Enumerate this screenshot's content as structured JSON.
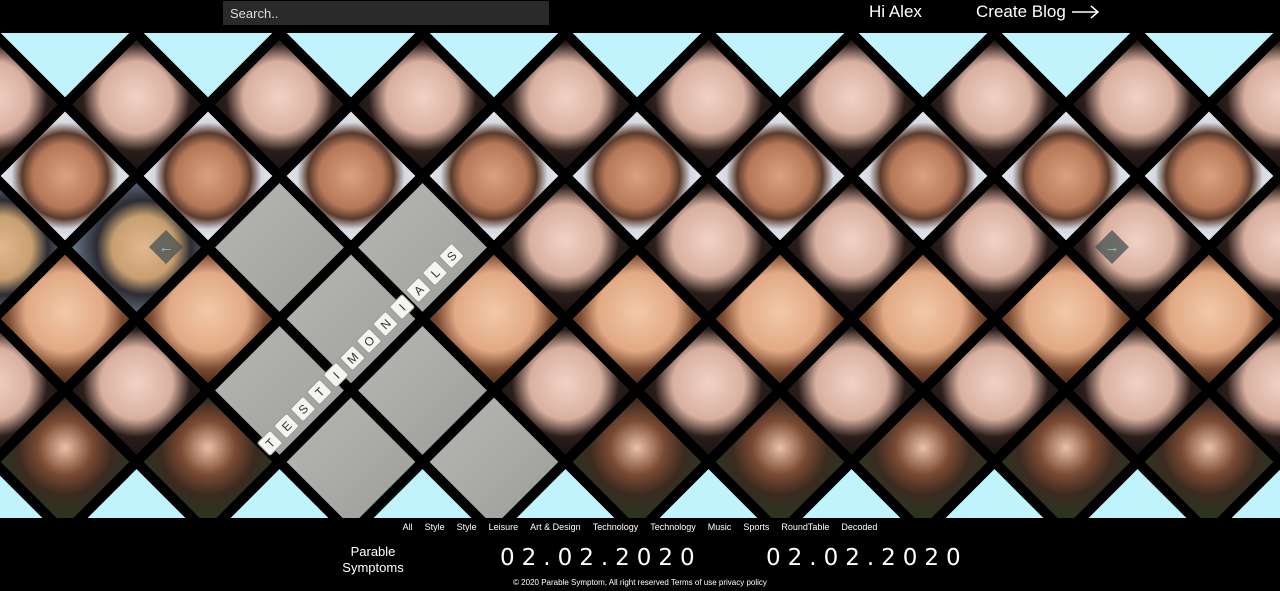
{
  "header": {
    "search_placeholder": "Search..",
    "greeting": "Hi Alex",
    "create_blog_label": "Create Blog"
  },
  "mosaic": {
    "testimonial_text": "TESTIMONIALS",
    "background_color": "#c0f3fb",
    "photos": [
      "woman-brown-hair",
      "woman-dark-hair",
      "man-beard",
      "woman-beanie",
      "woman-long-hair-outdoors"
    ],
    "prev_arrow": "arrow-left-icon",
    "next_arrow": "arrow-right-icon"
  },
  "footer": {
    "categories": [
      "All",
      "Style",
      "Style",
      "Leisure",
      "Art & Design",
      "Technology",
      "Technology",
      "Music",
      "Sports",
      "RoundTable",
      "Decoded"
    ],
    "brand": "Parable Symptoms",
    "date_left": "02.02.2020",
    "date_right": "02.02.2020",
    "copyright": "© 2020 Parable Symptom, All right reserved Terms of use privacy policy"
  }
}
